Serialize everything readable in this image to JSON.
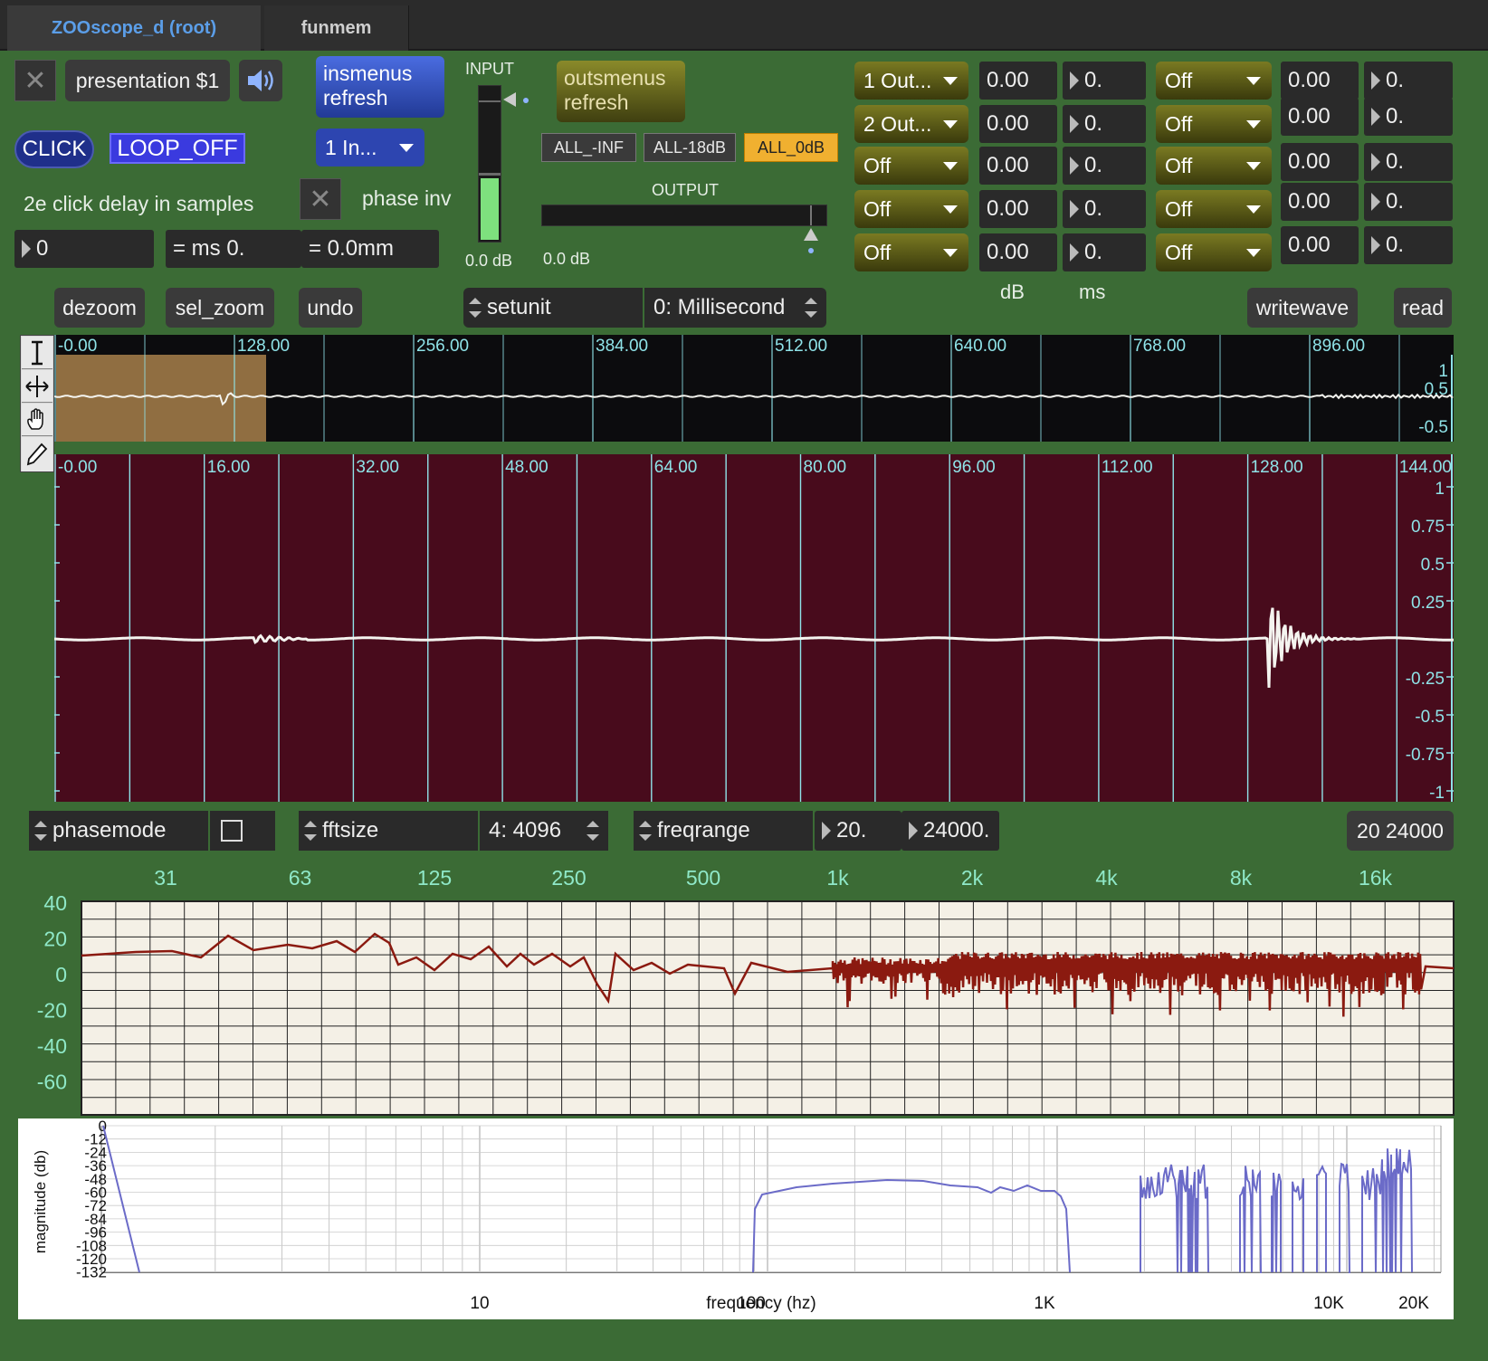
{
  "tabs": {
    "root": "ZOOscope_d (root)",
    "funmem": "funmem"
  },
  "controls": {
    "presentation": "presentation $1",
    "insmenus": [
      "insmenus",
      "refresh"
    ],
    "outsmenus": [
      "outsmenus",
      "refresh"
    ],
    "click": "CLICK",
    "loop": "LOOP_OFF",
    "input_menu": "1 In...",
    "click_delay_label": "2e click  delay in samples",
    "phase_inv_label": "phase inv",
    "delay_samples": "0",
    "ms_display": "= ms 0.",
    "mm_display": "= 0.0mm",
    "input_label": "INPUT",
    "output_label": "OUTPUT",
    "input_db": "0.0 dB",
    "output_db": "0.0 dB",
    "all_buttons": [
      "ALL_-INF",
      "ALL-18dB",
      "ALL_0dB"
    ]
  },
  "outputs": {
    "left_menus": [
      "1 Out...",
      "2 Out...",
      "Off",
      "Off",
      "Off"
    ],
    "left_db": [
      "0.00",
      "0.00",
      "0.00",
      "0.00",
      "0.00"
    ],
    "left_ms": [
      "0.",
      "0.",
      "0.",
      "0.",
      "0."
    ],
    "right_menus": [
      "Off",
      "Off",
      "Off",
      "Off",
      "Off"
    ],
    "right_db": [
      "0.00",
      "0.00",
      "0.00",
      "0.00",
      "0.00"
    ],
    "right_ms": [
      "0.",
      "0.",
      "0.",
      "0.",
      "0."
    ],
    "db_label": "dB",
    "ms_label": "ms"
  },
  "toolbar": {
    "dezoom": "dezoom",
    "sel_zoom": "sel_zoom",
    "undo": "undo",
    "setunit": "setunit",
    "unit_value": "0: Millisecond",
    "writewave": "writewave",
    "read": "read"
  },
  "overview": {
    "ticks": [
      "-0.00",
      "128.00",
      "256.00",
      "384.00",
      "512.00",
      "640.00",
      "768.00",
      "896.00"
    ],
    "y_labels": [
      "1",
      "0.5",
      "-0.5"
    ]
  },
  "zoomed": {
    "ticks": [
      "-0.00",
      "16.00",
      "32.00",
      "48.00",
      "64.00",
      "80.00",
      "96.00",
      "112.00",
      "128.00",
      "144.00"
    ],
    "y_labels": [
      "1",
      "0.75",
      "0.5",
      "0.25",
      "-0.25",
      "-0.5",
      "-0.75",
      "-1"
    ]
  },
  "fft_controls": {
    "phasemode": "phasemode",
    "fftsize": "fftsize",
    "fftsize_value": "4: 4096",
    "freqrange": "freqrange",
    "freq_min": "20.",
    "freq_max": "24000.",
    "range_display": "20 24000"
  },
  "spectrum": {
    "freq_labels": [
      "31",
      "63",
      "125",
      "250",
      "500",
      "1k",
      "2k",
      "4k",
      "8k",
      "16k"
    ],
    "db_labels": [
      "40",
      "20",
      "0",
      "-20",
      "-40",
      "-60"
    ],
    "line_color": "#8b1a10"
  },
  "magplot": {
    "y_labels": [
      "0",
      "-12",
      "-24",
      "-36",
      "-48",
      "-60",
      "-72",
      "-84",
      "-96",
      "-108",
      "-120",
      "-132"
    ],
    "x_labels": [
      "10",
      "100",
      "1K",
      "10K",
      "20K"
    ],
    "ylabel": "magnitude (db)",
    "xlabel": "frequency (hz)",
    "line_color": "#6b6bc8"
  }
}
